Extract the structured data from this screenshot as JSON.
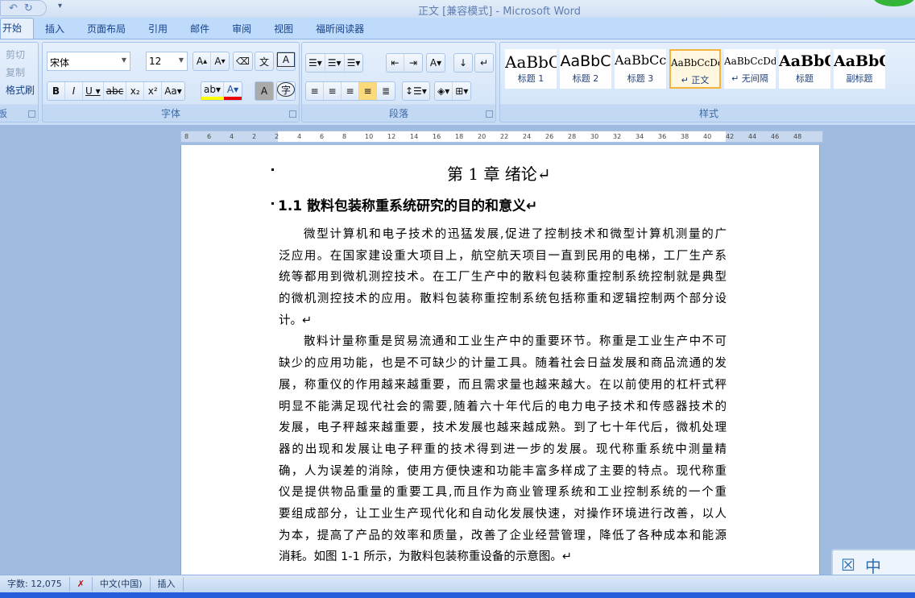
{
  "window": {
    "title": "正文 [兼容模式] - Microsoft Word"
  },
  "qat": {
    "undo": "↶",
    "redo": "↻",
    "more": "▾"
  },
  "tabs": [
    "开始",
    "插入",
    "页面布局",
    "引用",
    "邮件",
    "审阅",
    "视图",
    "福昕阅读器"
  ],
  "clipboard": {
    "cut": "剪切",
    "copy": "复制",
    "format_painter": "格式刷",
    "label": "板"
  },
  "font": {
    "name": "宋体",
    "size": "12",
    "label": "字体"
  },
  "paragraph": {
    "label": "段落"
  },
  "styles": {
    "label": "样式",
    "items": [
      {
        "sample": "AaBbC",
        "name": "标题 1"
      },
      {
        "sample": "AaBbC",
        "name": "标题 2"
      },
      {
        "sample": "AaBbCc",
        "name": "标题 3"
      },
      {
        "sample": "AaBbCcDd",
        "name": "↵ 正文"
      },
      {
        "sample": "AaBbCcDd",
        "name": "↵ 无间隔"
      },
      {
        "sample": "AaBbC",
        "name": "标题"
      },
      {
        "sample": "AaBbC",
        "name": "副标题"
      }
    ]
  },
  "ruler": [
    "8",
    "6",
    "4",
    "2",
    "2",
    "4",
    "6",
    "8",
    "10",
    "12",
    "14",
    "16",
    "18",
    "20",
    "22",
    "24",
    "26",
    "28",
    "30",
    "32",
    "34",
    "36",
    "38",
    "40",
    "42",
    "44",
    "46",
    "48"
  ],
  "document": {
    "chapter": "第 1 章  绪论↵",
    "section": "1.1 散料包装称重系统研究的目的和意义↵",
    "lines": [
      "微型计算机和电子技术的迅猛发展,促进了控制技术和微型计算机测量的广",
      "泛应用。在国家建设重大项目上，航空航天项目一直到民用的电梯，工厂生产系",
      "统等都用到微机测控技术。在工厂生产中的散料包装称重控制系统控制就是典型",
      "的微机测控技术的应用。散料包装称重控制系统包括称重和逻辑控制两个部分设",
      "计。↵",
      "散料计量称重是贸易流通和工业生产中的重要环节。称重是工业生产中不可",
      "缺少的应用功能，也是不可缺少的计量工具。随着社会日益发展和商品流通的发",
      "展，称重仪的作用越来越重要，而且需求量也越来越大。在以前使用的杠杆式秤",
      "明显不能满足现代社会的需要,随着六十年代后的电力电子技术和传感器技术的",
      "发展，电子秤越来越重要，技术发展也越来越成熟。到了七十年代后，微机处理",
      "器的出现和发展让电子秤重的技术得到进一步的发展。现代称重系统中测量精",
      "确，人为误差的消除，使用方便快速和功能丰富多样成了主要的特点。现代称重",
      "仪是提供物品重量的重要工具,而且作为商业管理系统和工业控制系统的一个重",
      "要组成部分，让工业生产现代化和自动化发展快速，对操作环境进行改善，以人",
      "为本，提高了产品的效率和质量，改善了企业经营管理，降低了各种成本和能源",
      "消耗。如图 1-1 所示，为散料包装称重设备的示意图。↵"
    ]
  },
  "status": {
    "word_count": "字数: 12,075",
    "language": "中文(中国)",
    "mode": "插入"
  },
  "ime": {
    "label": "中"
  }
}
